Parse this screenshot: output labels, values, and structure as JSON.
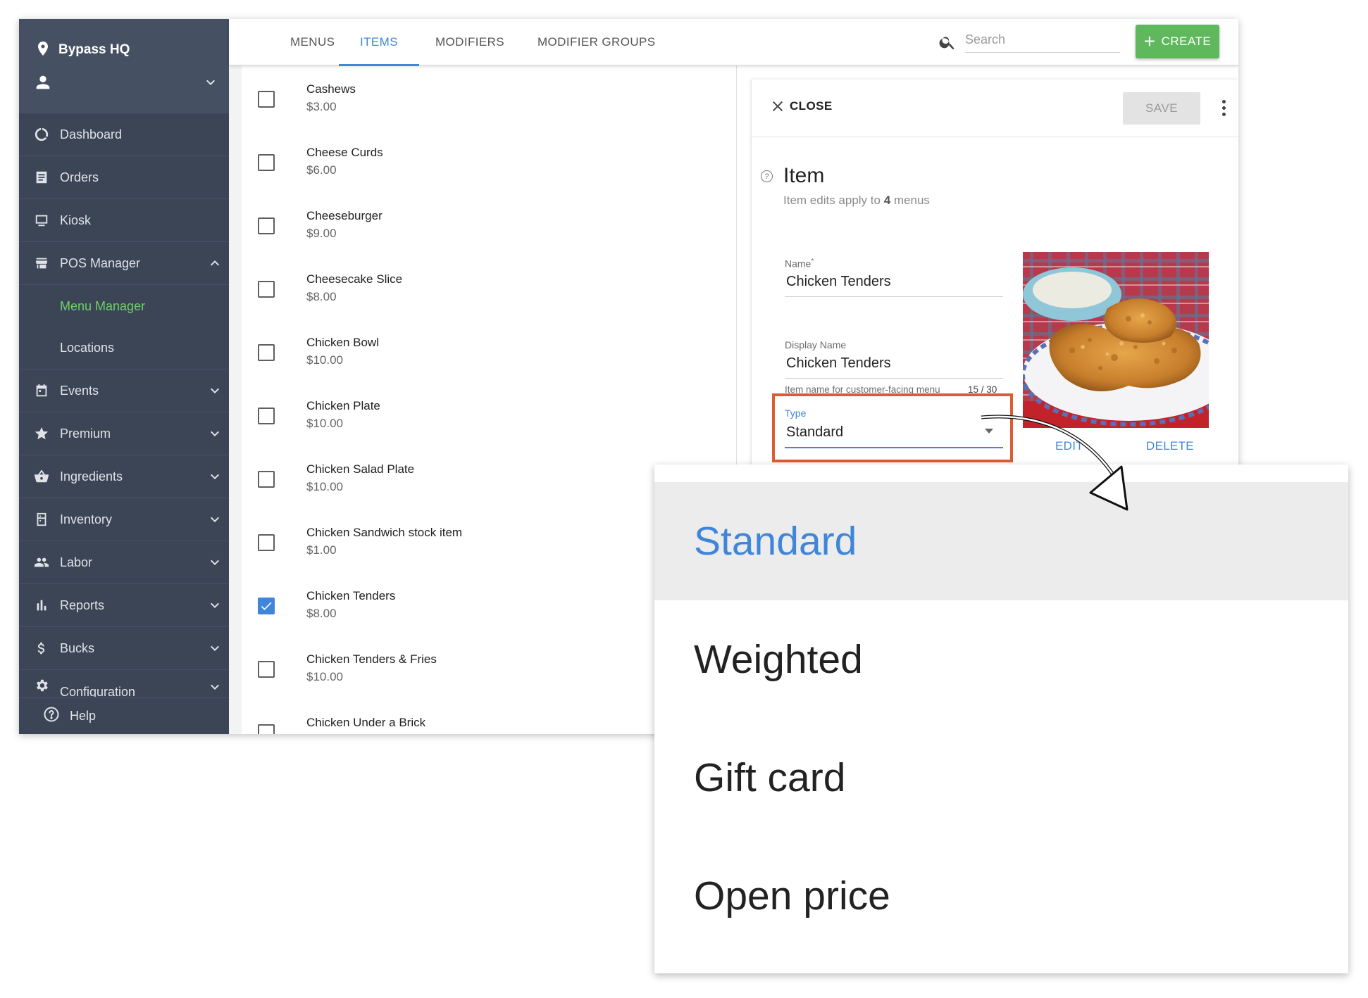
{
  "sidebar": {
    "location": "Bypass HQ",
    "nav": [
      {
        "label": "Dashboard",
        "icon": "dashboard-icon"
      },
      {
        "label": "Orders",
        "icon": "orders-icon"
      },
      {
        "label": "Kiosk",
        "icon": "kiosk-icon"
      },
      {
        "label": "POS Manager",
        "icon": "store-icon"
      }
    ],
    "pos_sub": [
      "Menu Manager",
      "Locations"
    ],
    "nav2": [
      {
        "label": "Events",
        "icon": "calendar-icon"
      },
      {
        "label": "Premium",
        "icon": "star-icon"
      },
      {
        "label": "Ingredients",
        "icon": "basket-icon"
      },
      {
        "label": "Inventory",
        "icon": "inventory-icon"
      },
      {
        "label": "Labor",
        "icon": "people-icon"
      },
      {
        "label": "Reports",
        "icon": "bar-chart-icon"
      },
      {
        "label": "Bucks",
        "icon": "dollar-icon"
      },
      {
        "label": "Configuration",
        "icon": "gear-icon"
      }
    ],
    "help": "Help"
  },
  "tabs": [
    "MENUS",
    "ITEMS",
    "MODIFIERS",
    "MODIFIER GROUPS"
  ],
  "active_tab": "ITEMS",
  "search": {
    "placeholder": "Search"
  },
  "create_label": "CREATE",
  "items": [
    {
      "name": "Cashews",
      "price": "$3.00",
      "checked": false
    },
    {
      "name": "Cheese Curds",
      "price": "$6.00",
      "checked": false
    },
    {
      "name": "Cheeseburger",
      "price": "$9.00",
      "checked": false
    },
    {
      "name": "Cheesecake Slice",
      "price": "$8.00",
      "checked": false
    },
    {
      "name": "Chicken Bowl",
      "price": "$10.00",
      "checked": false
    },
    {
      "name": "Chicken Plate",
      "price": "$10.00",
      "checked": false
    },
    {
      "name": "Chicken Salad Plate",
      "price": "$10.00",
      "checked": false
    },
    {
      "name": "Chicken Sandwich stock item",
      "price": "$1.00",
      "checked": false
    },
    {
      "name": "Chicken Tenders",
      "price": "$8.00",
      "checked": true
    },
    {
      "name": "Chicken Tenders & Fries",
      "price": "$10.00",
      "checked": false
    },
    {
      "name": "Chicken Under a Brick",
      "price": "",
      "checked": false
    }
  ],
  "panel": {
    "close_label": "CLOSE",
    "save_label": "SAVE",
    "title": "Item",
    "sub_prefix": "Item edits apply to",
    "sub_count": "4",
    "sub_suffix": "menus",
    "name_label": "Name",
    "name_required": "*",
    "name_value": "Chicken Tenders",
    "display_label": "Display Name",
    "display_value": "Chicken Tenders",
    "display_hint": "Item name for customer-facing menu",
    "display_count": "15 / 30",
    "type_label": "Type",
    "type_value": "Standard",
    "edit_label": "EDIT",
    "delete_label": "DELETE"
  },
  "dropdown": {
    "options": [
      "Standard",
      "Weighted",
      "Gift card",
      "Open price"
    ],
    "selected": "Standard"
  },
  "colors": {
    "sidebar_bg": "#3b4555",
    "accent_blue": "#3f86da",
    "active_green": "#6fcf6a",
    "create_green": "#5fb85c",
    "highlight_orange": "#dd5c32"
  }
}
